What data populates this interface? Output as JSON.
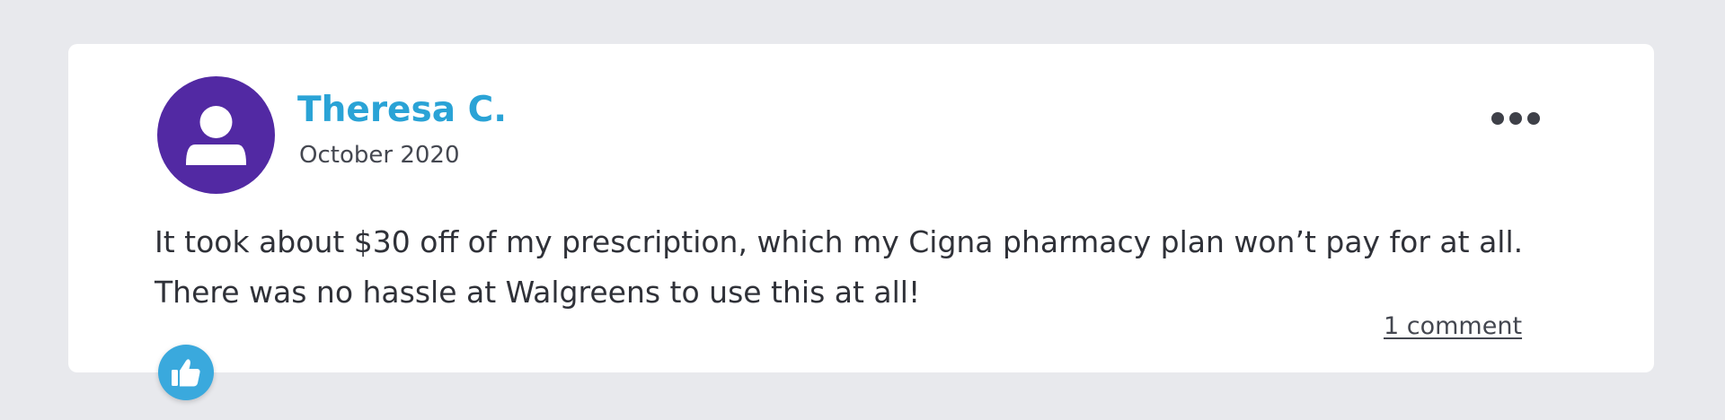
{
  "review": {
    "author": "Theresa C.",
    "date": "October 2020",
    "text_lines": [
      "It took about $30 off of my prescription, which my Cigna pharmacy plan won’t pay for at all.",
      "There was no hassle at Walgreens to use this at all!"
    ],
    "comments_label": "1 comment"
  },
  "icons": {
    "avatar": "user-icon",
    "more": "more-horizontal-icon",
    "like": "thumbs-up-icon"
  },
  "colors": {
    "background": "#e8e9ed",
    "card": "#ffffff",
    "avatar": "#5229a3",
    "author_name": "#2aa3d6",
    "like_button": "#3aa9dd",
    "text": "#2f3138"
  }
}
